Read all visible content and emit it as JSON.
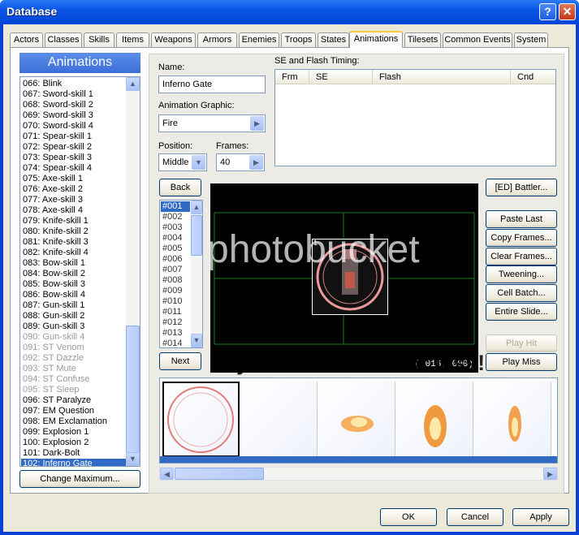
{
  "window": {
    "title": "Database",
    "help_glyph": "?",
    "close_glyph": "✕"
  },
  "tabs": [
    {
      "label": "Actors"
    },
    {
      "label": "Classes"
    },
    {
      "label": "Skills"
    },
    {
      "label": "Items"
    },
    {
      "label": "Weapons"
    },
    {
      "label": "Armors"
    },
    {
      "label": "Enemies"
    },
    {
      "label": "Troops"
    },
    {
      "label": "States"
    },
    {
      "label": "Animations"
    },
    {
      "label": "Tilesets"
    },
    {
      "label": "Common Events"
    },
    {
      "label": "System"
    }
  ],
  "active_tab": "Animations",
  "sidebar": {
    "header": "Animations",
    "items": [
      "066: Blink",
      "067: Sword-skill 1",
      "068: Sword-skill 2",
      "069: Sword-skill 3",
      "070: Sword-skill 4",
      "071: Spear-skill 1",
      "072: Spear-skill 2",
      "073: Spear-skill 3",
      "074: Spear-skill 4",
      "075: Axe-skill 1",
      "076: Axe-skill 2",
      "077: Axe-skill 3",
      "078: Axe-skill 4",
      "079: Knife-skill 1",
      "080: Knife-skill 2",
      "081: Knife-skill 3",
      "082: Knife-skill 4",
      "083: Bow-skill 1",
      "084: Bow-skill 2",
      "085: Bow-skill 3",
      "086: Bow-skill 4",
      "087: Gun-skill 1",
      "088: Gun-skill 2",
      "089: Gun-skill 3",
      "090: Gun-skill 4",
      "091: ST Venom",
      "092: ST Dazzle",
      "093: ST Mute",
      "094: ST Confuse",
      "095: ST Sleep",
      "096: ST Paralyze",
      "097: EM Question",
      "098: EM Exclamation",
      "099: Explosion 1",
      "100: Explosion 2",
      "101: Dark-Bolt",
      "102: Inferno Gate"
    ],
    "dim_items": [
      24,
      25,
      26,
      27,
      28,
      29
    ],
    "selected_index": 36,
    "change_max_label": "Change Maximum..."
  },
  "form": {
    "name_label": "Name:",
    "name_value": "Inferno Gate",
    "graphic_label": "Animation Graphic:",
    "graphic_value": "Fire",
    "position_label": "Position:",
    "position_value": "Middle",
    "frames_label": "Frames:",
    "frames_value": "40",
    "se_label": "SE and Flash Timing:",
    "se_columns": [
      "Frm",
      "SE",
      "Flash",
      "Cnd"
    ]
  },
  "editor": {
    "back_label": "Back",
    "next_label": "Next",
    "frames": [
      "#001",
      "#002",
      "#003",
      "#004",
      "#005",
      "#006",
      "#007",
      "#008",
      "#009",
      "#010",
      "#011",
      "#012",
      "#013",
      "#014"
    ],
    "selected_frame": 0,
    "coord_readout": "( 016, 000)",
    "cell_index_label": "1",
    "battler_label": "[ED] Battler...",
    "paste_last_label": "Paste Last",
    "copy_frames_label": "Copy Frames...",
    "clear_frames_label": "Clear Frames...",
    "tweening_label": "Tweening...",
    "cell_batch_label": "Cell Batch...",
    "entire_slide_label": "Entire Slide...",
    "play_hit_label": "Play Hit",
    "play_miss_label": "Play Miss"
  },
  "watermark": {
    "brand": "photobucket",
    "tagline": "of your memories for less!"
  },
  "footer": {
    "ok_label": "OK",
    "cancel_label": "Cancel",
    "apply_label": "Apply"
  },
  "colors": {
    "selection": "#316ac5",
    "title_bar": "#0a55e5",
    "tab_highlight": "#ffc73c"
  }
}
